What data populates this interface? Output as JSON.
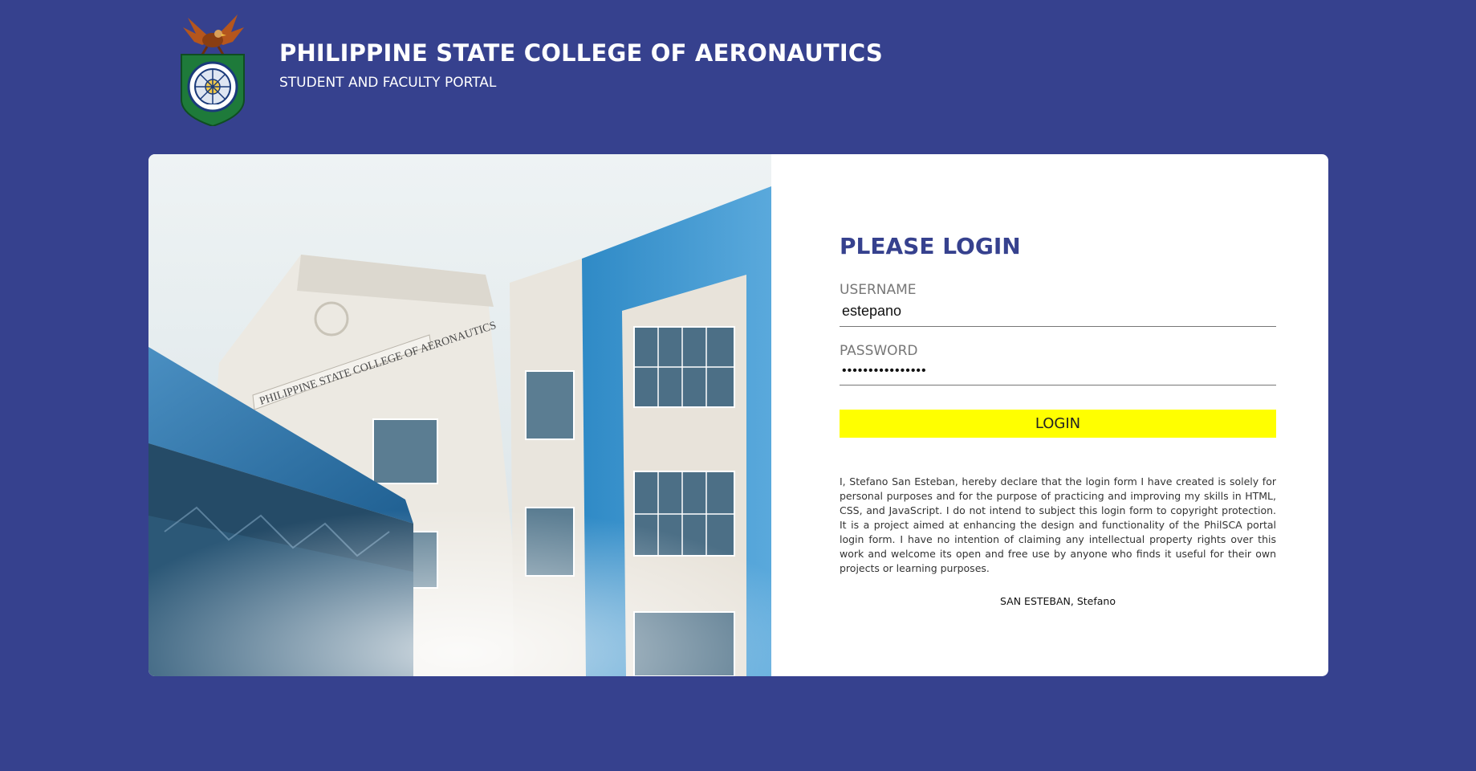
{
  "header": {
    "title": "PHILIPPINE STATE COLLEGE OF AERONAUTICS",
    "subtitle": "STUDENT AND FACULTY PORTAL",
    "logo_icon": "philsca-seal-eagle-icon"
  },
  "photo": {
    "building_sign": "PHILIPPINE STATE COLLEGE OF AERONAUTICS"
  },
  "login": {
    "heading": "PLEASE LOGIN",
    "username_label": "USERNAME",
    "username_value": "estepano",
    "password_label": "PASSWORD",
    "password_value": "••••••••••••••••",
    "button_label": "LOGIN",
    "disclaimer": "I, Stefano San Esteban, hereby declare that the login form I have created is solely for personal purposes and for the purpose of practicing and improving my skills in HTML, CSS, and JavaScript. I do not intend to subject this login form to copyright protection. It is a project aimed at enhancing the design and functionality of the PhilSCA portal login form. I have no intention of claiming any intellectual property rights over this work and welcome its open and free use by anyone who finds it useful for their own projects or learning purposes.",
    "signature": "SAN ESTEBAN, Stefano"
  },
  "colors": {
    "background": "#36418e",
    "heading": "#36418e",
    "button": "#ffff00",
    "card": "#ffffff"
  }
}
